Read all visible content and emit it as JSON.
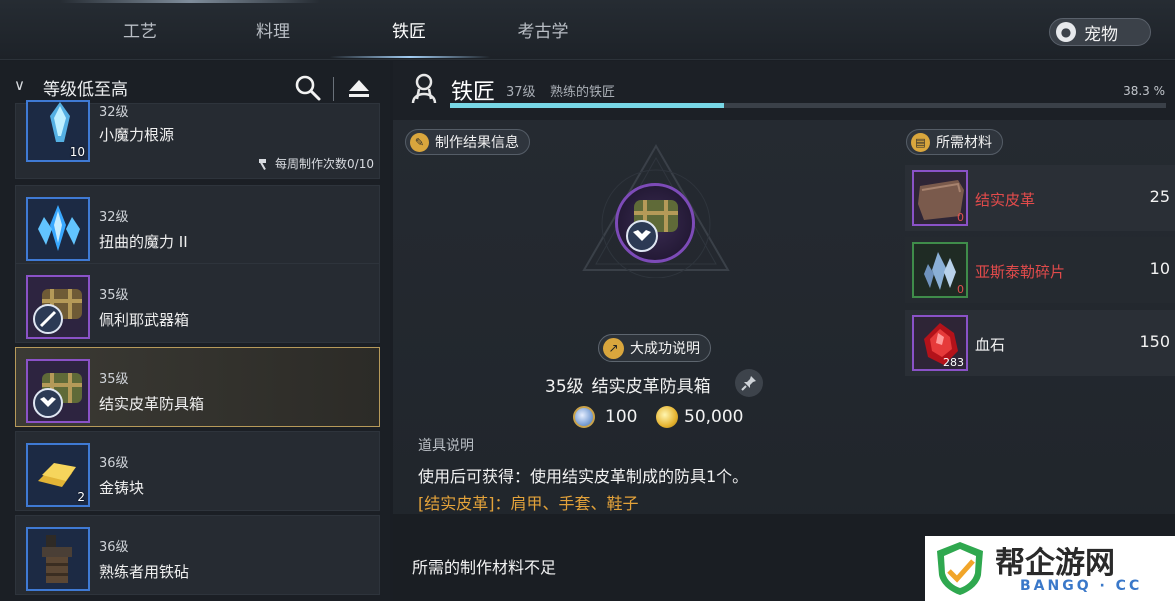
{
  "tabs": [
    {
      "label": "工艺",
      "active": false
    },
    {
      "label": "料理",
      "active": false
    },
    {
      "label": "铁匠",
      "active": true
    },
    {
      "label": "考古学",
      "active": false
    }
  ],
  "pet_button": {
    "label": "宠物",
    "icon": "paw-icon"
  },
  "sort": {
    "label": "等级低至高"
  },
  "recipes": [
    {
      "level": "32级",
      "name": "小魔力根源",
      "qty": "10",
      "weekly": "每周制作次数0/10",
      "frame": "blue",
      "selected": false
    },
    {
      "level": "32级",
      "name": "扭曲的魔力 II",
      "qty": "",
      "weekly": "",
      "frame": "blue",
      "selected": false
    },
    {
      "level": "35级",
      "name": "佩利耶武器箱",
      "qty": "",
      "weekly": "",
      "frame": "purple",
      "selected": false
    },
    {
      "level": "35级",
      "name": "结实皮革防具箱",
      "qty": "",
      "weekly": "",
      "frame": "purple",
      "selected": true
    },
    {
      "level": "36级",
      "name": "金铸块",
      "qty": "2",
      "weekly": "",
      "frame": "blue",
      "selected": false
    },
    {
      "level": "36级",
      "name": "熟练者用铁砧",
      "qty": "",
      "weekly": "",
      "frame": "blue",
      "selected": false
    }
  ],
  "skill": {
    "title": "铁匠",
    "level": "37级",
    "rank": "熟练的铁匠",
    "progress_text": "38.3 %",
    "progress": 0.383
  },
  "result_info": {
    "pill_label": "制作结果信息",
    "success_label": "大成功说明",
    "product_level": "35级",
    "product_name": "结实皮革防具箱",
    "silver_cost": "100",
    "gold_cost": "50,000",
    "desc_title": "道具说明",
    "desc_line1": "使用后可获得：使用结实皮革制成的防具1个。",
    "desc_line2": "[结实皮革]：肩甲、手套、鞋子"
  },
  "materials": {
    "pill_label": "所需材料",
    "items": [
      {
        "name": "结实皮革",
        "have": "0",
        "need": "25",
        "enough": false,
        "frame": "purple"
      },
      {
        "name": "亚斯泰勒碎片",
        "have": "0",
        "need": "10",
        "enough": false,
        "frame": "green"
      },
      {
        "name": "血石",
        "have": "283",
        "need": "150",
        "enough": true,
        "frame": "purple"
      }
    ]
  },
  "footer": {
    "message": "所需的制作材料不足"
  },
  "watermark": {
    "main": "帮企游网",
    "sub": "BANGQ · CC"
  },
  "colors": {
    "accent_progress": "#78d7e6",
    "insufficient": "#e24b4b",
    "selected_border": "#b79a5a",
    "desc_highlight": "#e3a23a"
  }
}
